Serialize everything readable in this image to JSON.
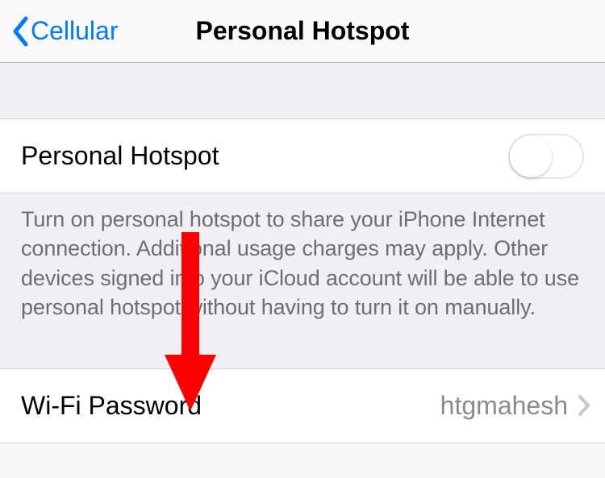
{
  "header": {
    "back_label": "Cellular",
    "title": "Personal Hotspot"
  },
  "hotspot_row": {
    "label": "Personal Hotspot",
    "enabled": false
  },
  "hotspot_description": "Turn on personal hotspot to share your iPhone Internet connection. Additional usage charges may apply. Other devices signed into your iCloud account will be able to use personal hotspot without having to turn it on manually.",
  "wifi_password_row": {
    "label": "Wi-Fi Password",
    "value": "htgmahesh"
  }
}
